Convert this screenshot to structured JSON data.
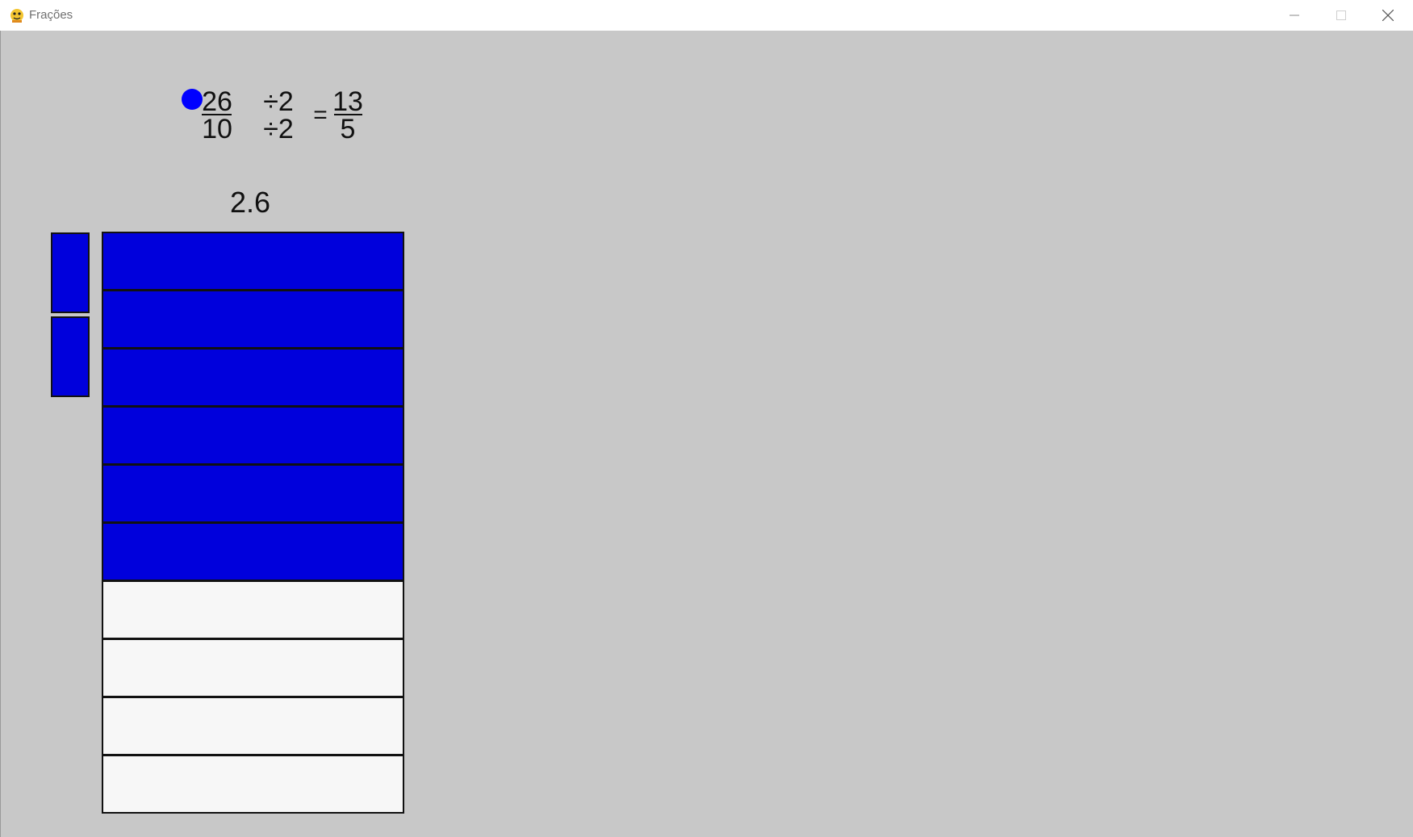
{
  "window": {
    "title": "Frações",
    "app_icon": "python-snake-icon"
  },
  "equation": {
    "numerator": "26",
    "denominator": "10",
    "op_numerator": "÷2",
    "op_denominator": "÷2",
    "equals": "=",
    "result_numerator": "13",
    "result_denominator": "5"
  },
  "decimal_value": "2.6",
  "colors": {
    "filled": "#0000dc",
    "empty": "#f7f7f7",
    "background": "#c8c8c8",
    "dot": "#0000ff"
  },
  "whole_units": 2,
  "parts": {
    "total": 10,
    "filled": 6
  }
}
